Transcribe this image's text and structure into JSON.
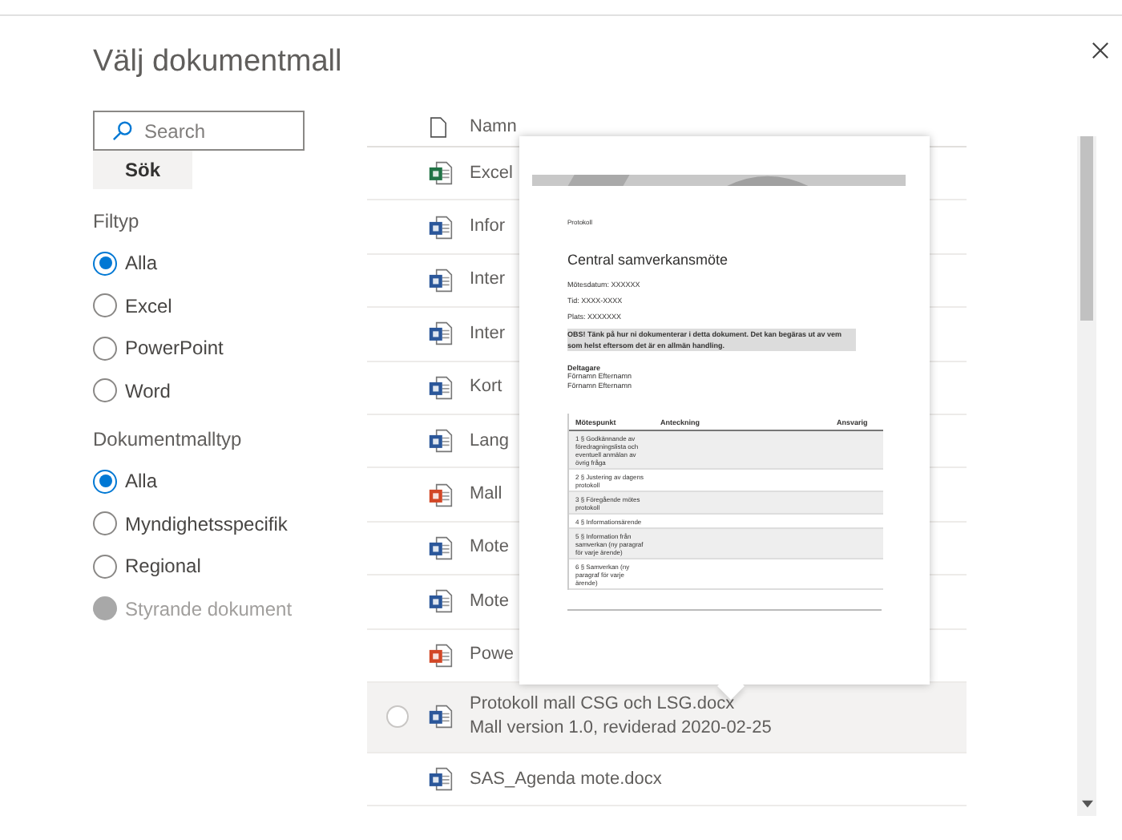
{
  "dialog": {
    "title": "Välj dokumentmall"
  },
  "search": {
    "placeholder": "Search",
    "button": "Sök"
  },
  "filters": [
    {
      "heading": "Filtyp",
      "options": [
        {
          "label": "Alla",
          "selected": true,
          "disabled": false
        },
        {
          "label": "Excel",
          "selected": false,
          "disabled": false
        },
        {
          "label": "PowerPoint",
          "selected": false,
          "disabled": false
        },
        {
          "label": "Word",
          "selected": false,
          "disabled": false
        }
      ]
    },
    {
      "heading": "Dokumentmalltyp",
      "options": [
        {
          "label": "Alla",
          "selected": true,
          "disabled": false
        },
        {
          "label": "Myndighetsspecifik",
          "selected": false,
          "disabled": false
        },
        {
          "label": "Regional",
          "selected": false,
          "disabled": false
        },
        {
          "label": "Styrande dokument",
          "selected": false,
          "disabled": true
        }
      ]
    }
  ],
  "list": {
    "column": "Namn",
    "rows": [
      {
        "kind": "excel",
        "name": "Excel",
        "selected": false
      },
      {
        "kind": "word",
        "name": "Infor",
        "selected": false
      },
      {
        "kind": "word",
        "name": "Inter",
        "selected": false
      },
      {
        "kind": "word",
        "name": "Inter",
        "selected": false
      },
      {
        "kind": "word",
        "name": "Kort",
        "selected": false
      },
      {
        "kind": "word",
        "name": "Lang",
        "selected": false
      },
      {
        "kind": "powerpoint",
        "name": "Mall",
        "selected": false
      },
      {
        "kind": "word",
        "name": "Mote",
        "selected": false
      },
      {
        "kind": "word",
        "name": "Mote",
        "selected": false
      },
      {
        "kind": "powerpoint",
        "name": "Powe",
        "selected": false
      },
      {
        "kind": "word",
        "name": "Protokoll mall CSG och LSG.docx",
        "subtitle": "Mall version 1.0, reviderad 2020-02-25",
        "selected": false,
        "hovered": true
      },
      {
        "kind": "word",
        "name": "SAS_Agenda mote.docx",
        "selected": false
      }
    ]
  },
  "preview": {
    "label": "Protokoll",
    "title": "Central samverkansmöte",
    "fields": [
      "Mötesdatum: XXXXXX",
      "Tid: XXXX-XXXX",
      "Plats: XXXXXXX"
    ],
    "notice": "OBS! Tänk på hur ni dokumenterar i detta dokument. Det kan begäras ut av vem som helst eftersom det är en allmän handling.",
    "participants_heading": "Deltagare",
    "participants": [
      "Förnamn Efternamn",
      "Förnamn Efternamn"
    ],
    "table": {
      "columns": [
        "Mötespunkt",
        "Anteckning",
        "Ansvarig"
      ],
      "rows": [
        "1 § Godkännande av föredragningslista och eventuell anmälan av övrig fråga",
        "2 § Justering av dagens protokoll",
        "3 § Föregående mötes protokoll",
        "4 § Informationsärende",
        "5 § Information från samverkan (ny paragraf för varje ärende)",
        "6 § Samverkan (ny paragraf för varje ärende)"
      ]
    }
  }
}
